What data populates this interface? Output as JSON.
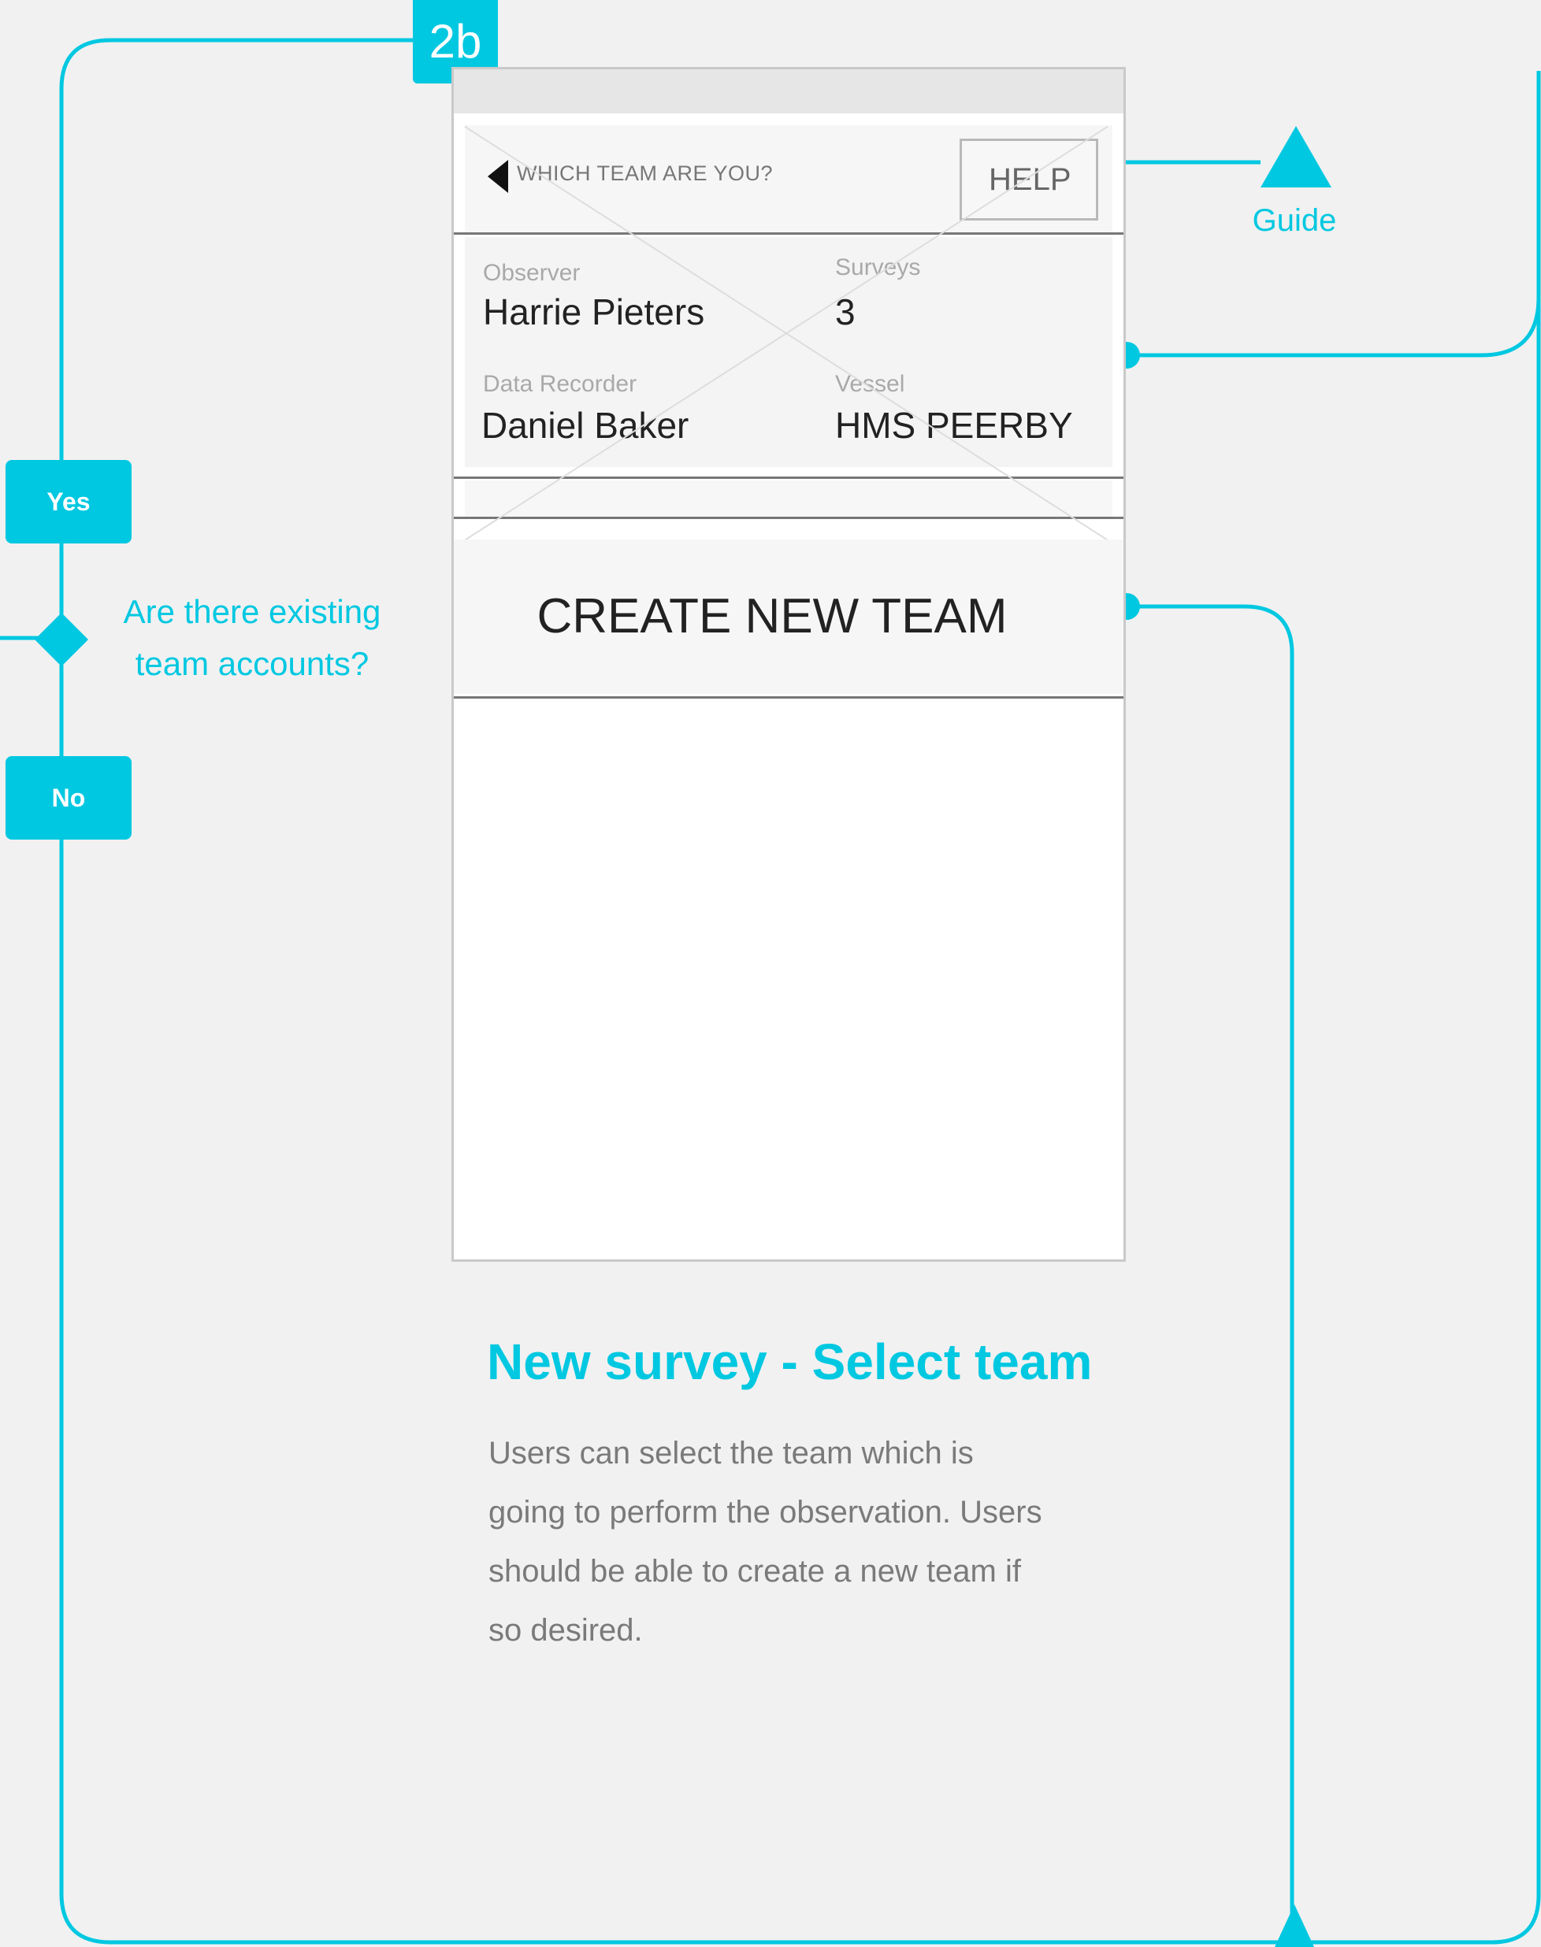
{
  "step_badge": "2b",
  "decision": {
    "question": "Are there existing team accounts?",
    "yes_label": "Yes",
    "no_label": "No"
  },
  "guide_label": "Guide",
  "screen": {
    "title": "WHICH TEAM ARE YOU?",
    "help_label": "HELP",
    "team": {
      "observer_label": "Observer",
      "observer_value": "Harrie Pieters",
      "surveys_label": "Surveys",
      "surveys_value": "3",
      "recorder_label": "Data Recorder",
      "recorder_value": "Daniel Baker",
      "vessel_label": "Vessel",
      "vessel_value": "HMS PEERBY"
    },
    "create_label": "CREATE NEW TEAM"
  },
  "description": {
    "title": "New survey - Select team",
    "text": "Users can select the team which is going to perform the observation. Users should be able to create a new team if so desired."
  },
  "colors": {
    "accent": "#00c8e1",
    "background": "#f1f1f1"
  }
}
